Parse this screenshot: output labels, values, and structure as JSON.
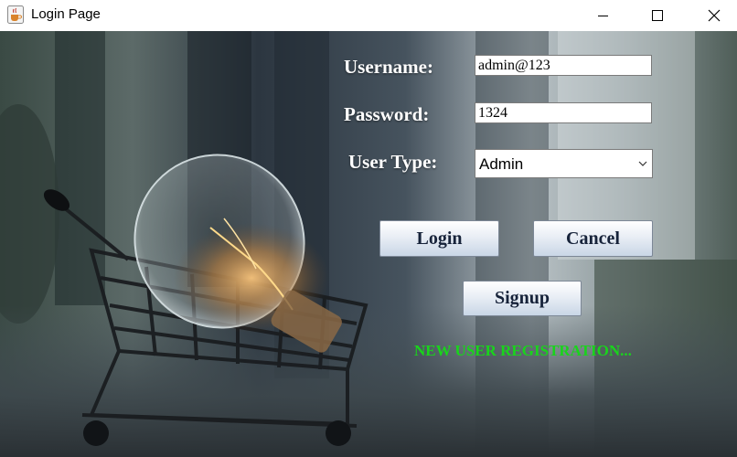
{
  "window": {
    "title": "Login Page",
    "app_icon": "java-cup-icon",
    "controls": [
      "minimize-icon",
      "maximize-icon",
      "close-icon"
    ]
  },
  "background": {
    "description_icon": "lightbulb-in-shopping-cart-photo"
  },
  "form": {
    "username_label": "Username:",
    "username_value": "admin@123",
    "password_label": "Password:",
    "password_value": "1324",
    "user_type_label": "User Type:",
    "user_type_selected": "Admin"
  },
  "buttons": {
    "login": "Login",
    "cancel": "Cancel",
    "signup": "Signup"
  },
  "registration_link": "NEW USER REGISTRATION...",
  "colors": {
    "link": "#19d41c",
    "label": "#ffffff",
    "button_text": "#17233a"
  }
}
